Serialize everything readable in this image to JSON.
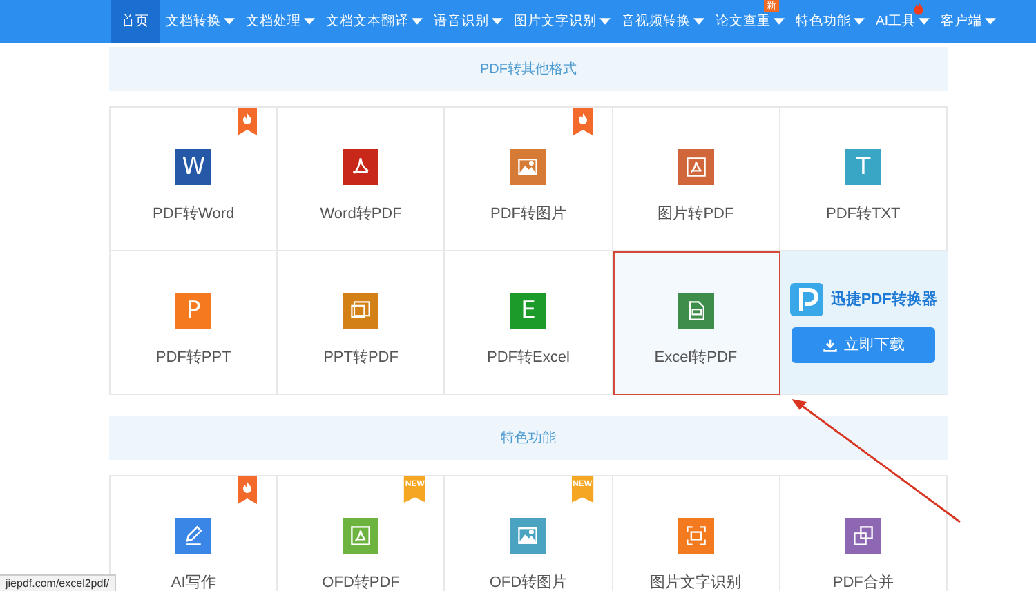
{
  "nav": [
    {
      "label": "首页",
      "selected": true,
      "caret": false
    },
    {
      "label": "文档转换",
      "selected": false,
      "caret": true
    },
    {
      "label": "文档处理",
      "selected": false,
      "caret": true
    },
    {
      "label": "文档文本翻译",
      "selected": false,
      "caret": true
    },
    {
      "label": "语音识别",
      "selected": false,
      "caret": true
    },
    {
      "label": "图片文字识别",
      "selected": false,
      "caret": true
    },
    {
      "label": "音视频转换",
      "selected": false,
      "caret": true
    },
    {
      "label": "论文查重",
      "selected": false,
      "caret": true,
      "badge": {
        "kind": "text",
        "text": "新"
      }
    },
    {
      "label": "特色功能",
      "selected": false,
      "caret": true
    },
    {
      "label": "AI工具",
      "selected": false,
      "caret": true,
      "badge": {
        "kind": "flame"
      }
    },
    {
      "label": "客户端",
      "selected": false,
      "caret": true
    }
  ],
  "sections": [
    {
      "title": "PDF转其他格式",
      "items": [
        {
          "label": "PDF转Word",
          "kind": "letter",
          "glyph": "W",
          "color": "#2559a8",
          "hot": true,
          "selected": false
        },
        {
          "label": "Word转PDF",
          "kind": "acrobat",
          "color": "#c8281a",
          "hot": false,
          "selected": false
        },
        {
          "label": "PDF转图片",
          "kind": "image",
          "color": "#d67b36",
          "hot": true,
          "selected": false
        },
        {
          "label": "图片转PDF",
          "kind": "framed",
          "color": "#d0663a",
          "hot": false,
          "selected": false
        },
        {
          "label": "PDF转TXT",
          "kind": "letter",
          "glyph": "T",
          "color": "#3aa6c6",
          "hot": false,
          "selected": false
        },
        {
          "label": "PDF转PPT",
          "kind": "letter",
          "glyph": "P",
          "color": "#f4791f",
          "hot": false,
          "selected": false
        },
        {
          "label": "PPT转PDF",
          "kind": "doc",
          "color": "#d38116",
          "hot": false,
          "selected": false
        },
        {
          "label": "PDF转Excel",
          "kind": "letter",
          "glyph": "E",
          "color": "#1c9b2a",
          "hot": false,
          "selected": false
        },
        {
          "label": "Excel转PDF",
          "kind": "page",
          "color": "#3f8d4a",
          "hot": false,
          "selected": true
        }
      ],
      "promo": {
        "name": "迅捷PDF转换器",
        "button": "立即下载"
      }
    },
    {
      "title": "特色功能",
      "items": [
        {
          "label": "AI写作",
          "kind": "pencil",
          "color": "#3a86e6",
          "hot": true,
          "selected": false
        },
        {
          "label": "OFD转PDF",
          "kind": "framed",
          "color": "#6cb33f",
          "hot": false,
          "ribbon_text": "NEW",
          "selected": false
        },
        {
          "label": "OFD转图片",
          "kind": "image",
          "color": "#4aa3c0",
          "hot": false,
          "ribbon_text": "NEW",
          "selected": false
        },
        {
          "label": "图片文字识别",
          "kind": "scan",
          "color": "#f47a1f",
          "hot": false,
          "selected": false
        },
        {
          "label": "PDF合并",
          "kind": "squares",
          "color": "#8e67b3",
          "hot": false,
          "selected": false
        }
      ]
    }
  ],
  "status_url": "jiepdf.com/excel2pdf/"
}
